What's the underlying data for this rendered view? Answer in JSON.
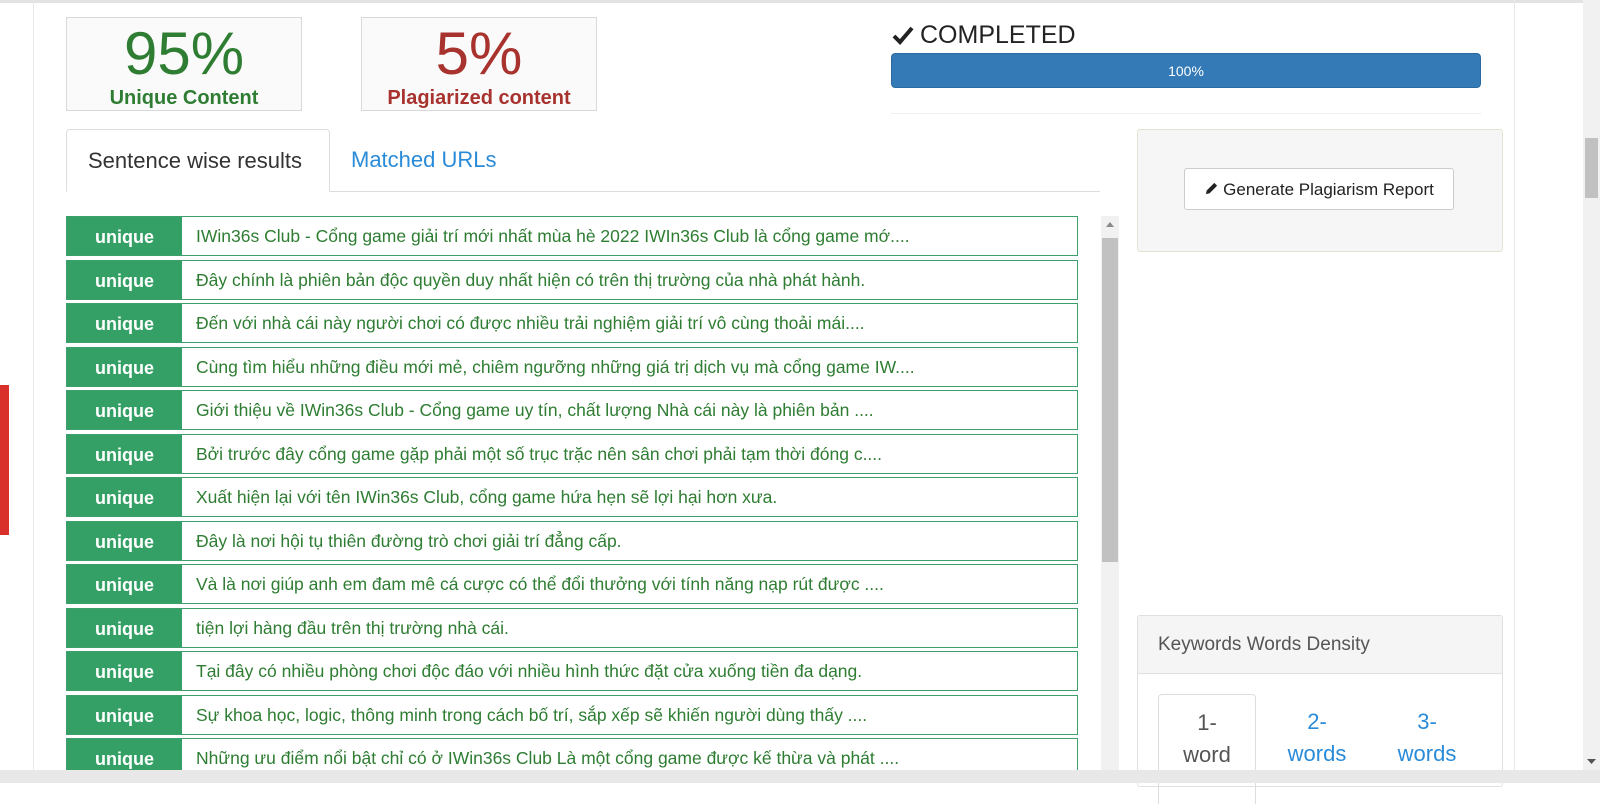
{
  "stats": {
    "unique": {
      "percent": "95%",
      "label": "Unique Content",
      "color": "#2e7d32"
    },
    "plagiarized": {
      "percent": "5%",
      "label": "Plagiarized content",
      "color": "#a8322d"
    }
  },
  "status": {
    "text": "COMPLETED",
    "progress_label": "100%",
    "progress": 1.0,
    "bar_color": "#337ab7"
  },
  "tabs": [
    {
      "label": "Sentence wise results",
      "active": true
    },
    {
      "label": "Matched URLs",
      "active": false
    }
  ],
  "results": [
    {
      "badge": "unique",
      "text": "IWin36s Club - Cổng game giải trí mới nhất mùa hè 2022 IWIn36s Club là cổng game mớ...."
    },
    {
      "badge": "unique",
      "text": "Đây chính là phiên bản độc quyền duy nhất hiện có trên thị trường của nhà phát hành."
    },
    {
      "badge": "unique",
      "text": "Đến với nhà cái này người chơi có được nhiều trải nghiệm giải trí vô cùng thoải mái...."
    },
    {
      "badge": "unique",
      "text": "Cùng tìm hiểu những điều mới mẻ, chiêm ngưỡng những giá trị dịch vụ mà cổng game IW...."
    },
    {
      "badge": "unique",
      "text": "Giới thiệu về IWin36s Club - Cổng game uy tín, chất lượng Nhà cái này là phiên bản ...."
    },
    {
      "badge": "unique",
      "text": "Bởi trước đây cổng game gặp phải một số trục trặc nên sân chơi phải tạm thời đóng c...."
    },
    {
      "badge": "unique",
      "text": "Xuất hiện lại với tên IWin36s Club, cổng game hứa hẹn sẽ lợi hại hơn xưa."
    },
    {
      "badge": "unique",
      "text": "Đây là nơi hội tụ thiên đường trò chơi giải trí đẳng cấp."
    },
    {
      "badge": "unique",
      "text": "Và là nơi giúp anh em đam mê cá cược có thể đổi thưởng với tính năng nạp rút được ...."
    },
    {
      "badge": "unique",
      "text": "tiện lợi hàng đầu trên thị trường nhà cái."
    },
    {
      "badge": "unique",
      "text": "Tại đây có nhiều phòng chơi độc đáo với nhiều hình thức đặt cửa xuống tiền đa dạng."
    },
    {
      "badge": "unique",
      "text": "Sự khoa học, logic, thông minh trong cách bố trí, sắp xếp sẽ khiến người dùng thấy ...."
    },
    {
      "badge": "unique",
      "text": "Những ưu điểm nổi bật chỉ có ở IWin36s Club Là một cổng game được kế thừa và phát ...."
    }
  ],
  "report_button": {
    "label": "Generate Plagiarism Report",
    "icon": "pencil-icon"
  },
  "keywords": {
    "title": "Keywords Words Density",
    "tabs": [
      {
        "line1": "1-",
        "line2": "word",
        "active": true
      },
      {
        "line1": "2-",
        "line2": "words",
        "active": false
      },
      {
        "line1": "3-",
        "line2": "words",
        "active": false
      }
    ]
  }
}
